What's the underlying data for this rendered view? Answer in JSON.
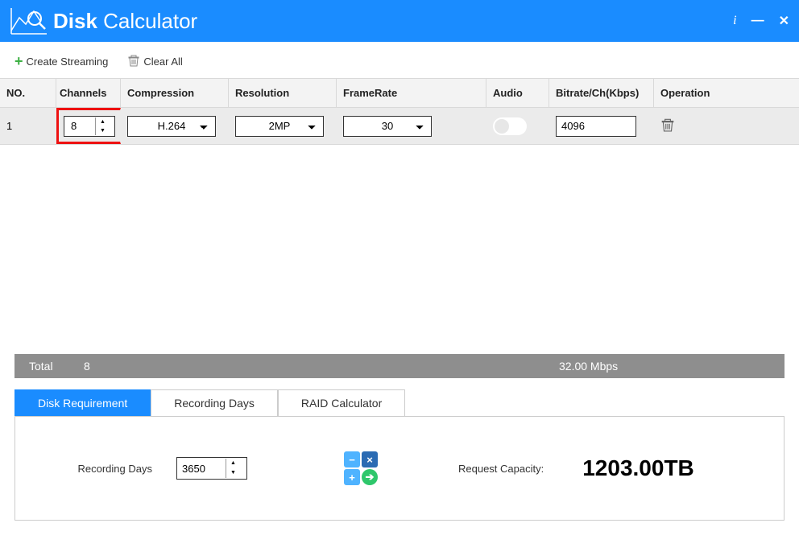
{
  "app": {
    "title_bold": "Disk",
    "title_light": "Calculator"
  },
  "toolbar": {
    "create": "Create Streaming",
    "clear": "Clear All"
  },
  "grid": {
    "headers": {
      "no": "NO.",
      "channels": "Channels",
      "compression": "Compression",
      "resolution": "Resolution",
      "framerate": "FrameRate",
      "audio": "Audio",
      "bitrate": "Bitrate/Ch(Kbps)",
      "operation": "Operation"
    },
    "rows": [
      {
        "no": "1",
        "channels": "8",
        "compression": "H.264",
        "resolution": "2MP",
        "framerate": "30",
        "audio": false,
        "bitrate": "4096"
      }
    ]
  },
  "totals": {
    "label": "Total",
    "channels": "8",
    "rate": "32.00 Mbps"
  },
  "tabs": {
    "disk": "Disk Requirement",
    "days": "Recording Days",
    "raid": "RAID Calculator"
  },
  "calc": {
    "recording_days_label": "Recording Days",
    "recording_days_value": "3650",
    "request_capacity_label": "Request Capacity:",
    "request_capacity_value": "1203.00TB"
  }
}
